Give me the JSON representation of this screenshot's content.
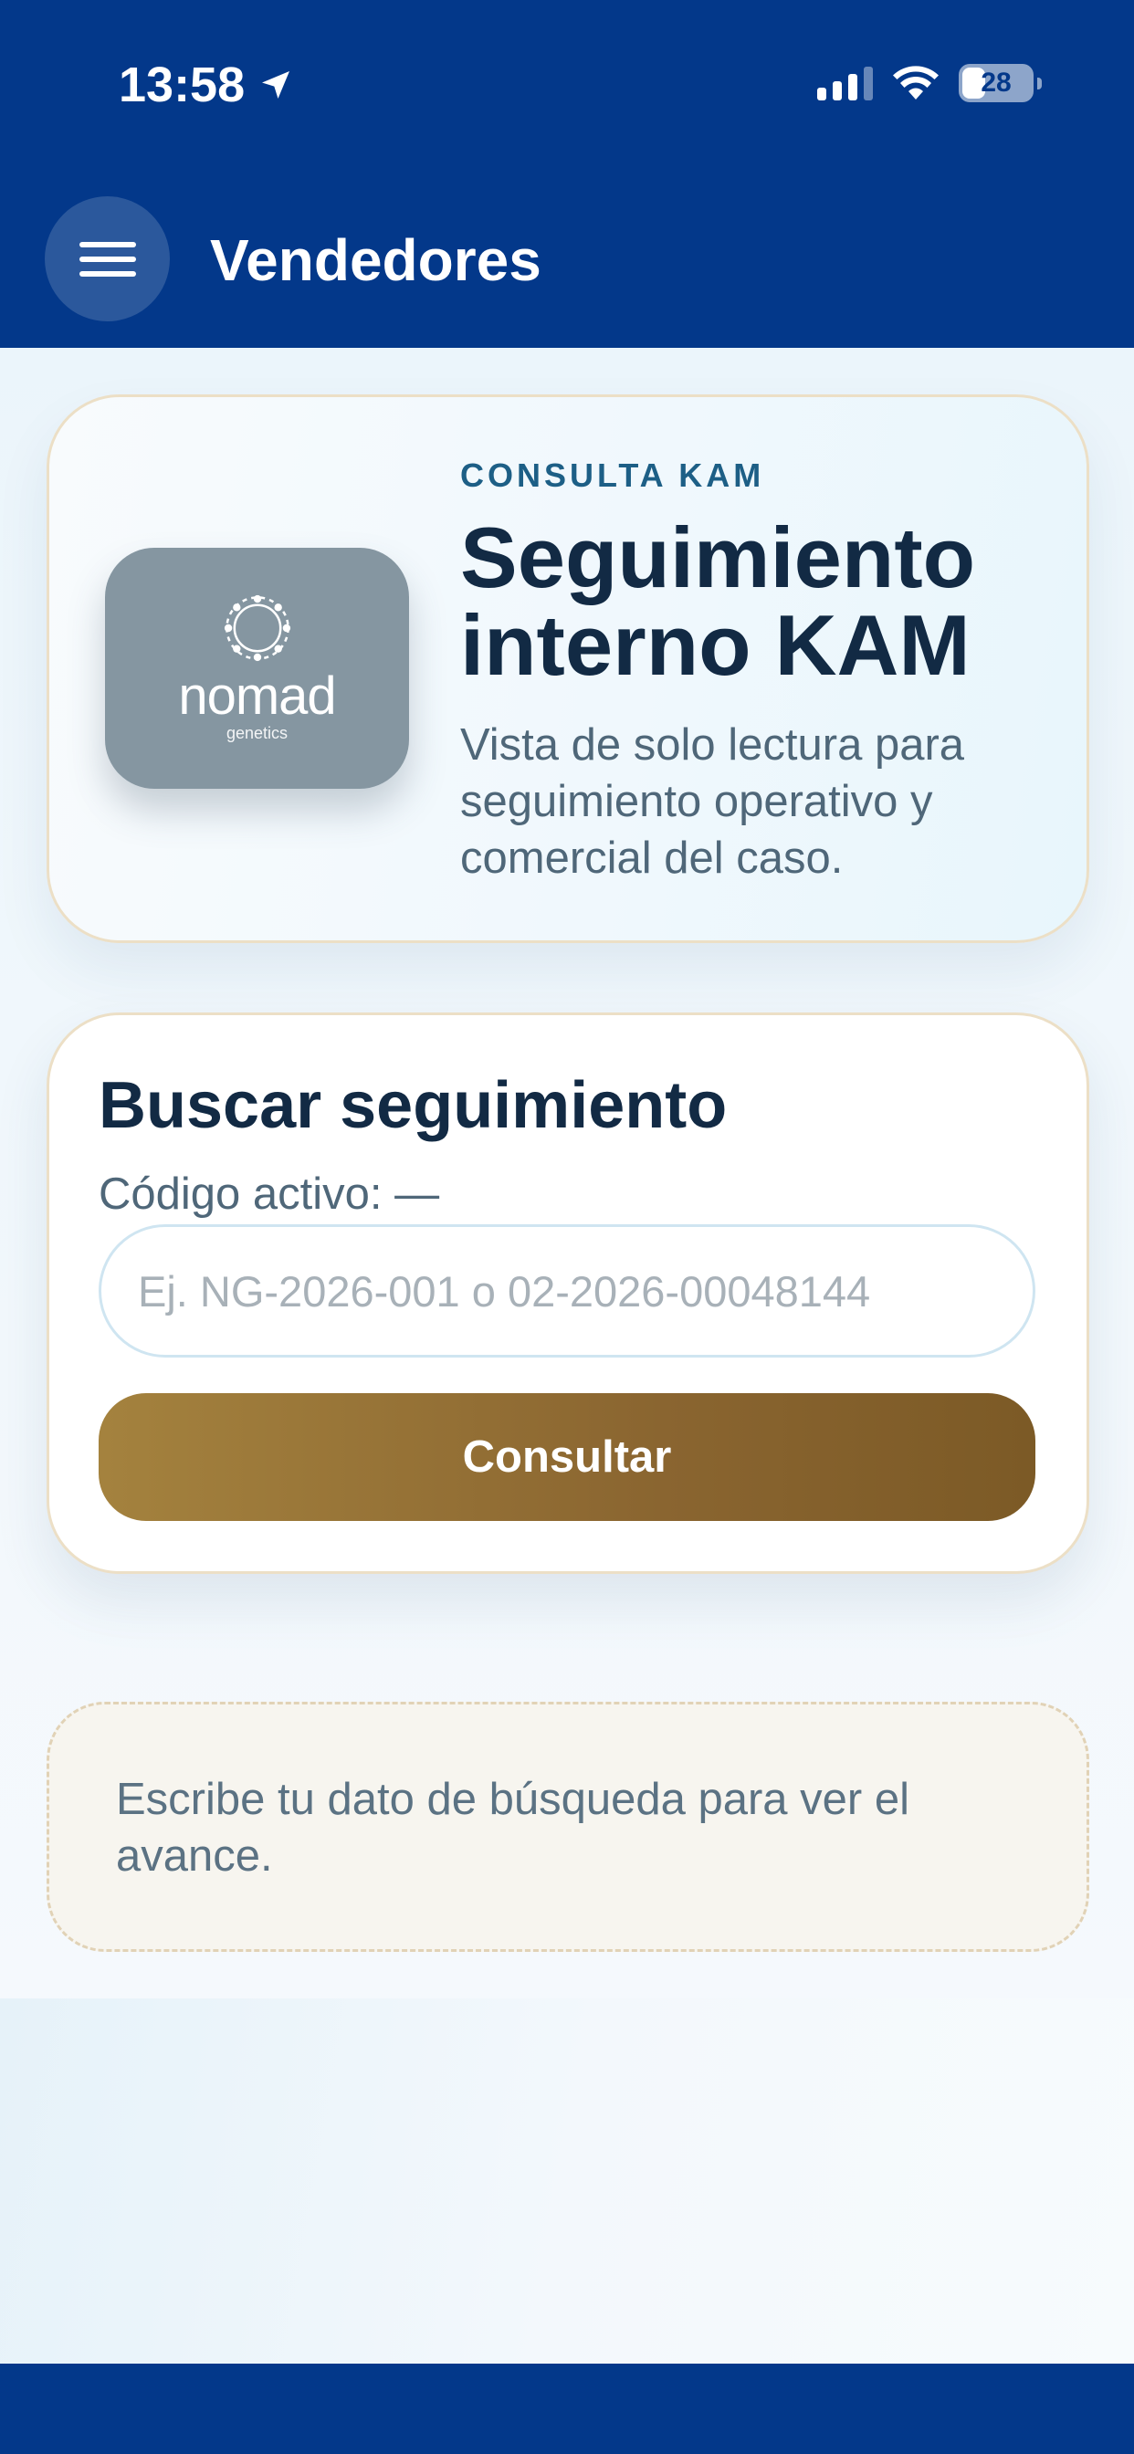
{
  "status_bar": {
    "time": "13:58",
    "battery": "28",
    "icons": [
      "location-arrow-icon",
      "signal-icon",
      "wifi-icon",
      "battery-icon"
    ]
  },
  "app_bar": {
    "title": "Vendedores",
    "menu_icon": "hamburger-menu-icon"
  },
  "hero": {
    "logo_word": "nomad",
    "logo_sub": "genetics",
    "eyebrow": "CONSULTA KAM",
    "title": "Seguimiento interno KAM",
    "description": "Vista de solo lectura para seguimiento operativo y comercial del caso."
  },
  "search": {
    "title": "Buscar seguimiento",
    "active_code": "Código activo: —",
    "input_value": "",
    "input_placeholder": "Ej. NG-2026-001 o 02-2026-00048144",
    "button_label": "Consultar"
  },
  "notice": {
    "text": "Escribe tu dato de búsqueda para ver el avance."
  },
  "colors": {
    "primary": "#03388a",
    "accent_gold": "#8a6530",
    "heading": "#122a44",
    "eyebrow": "#1d5f86"
  }
}
